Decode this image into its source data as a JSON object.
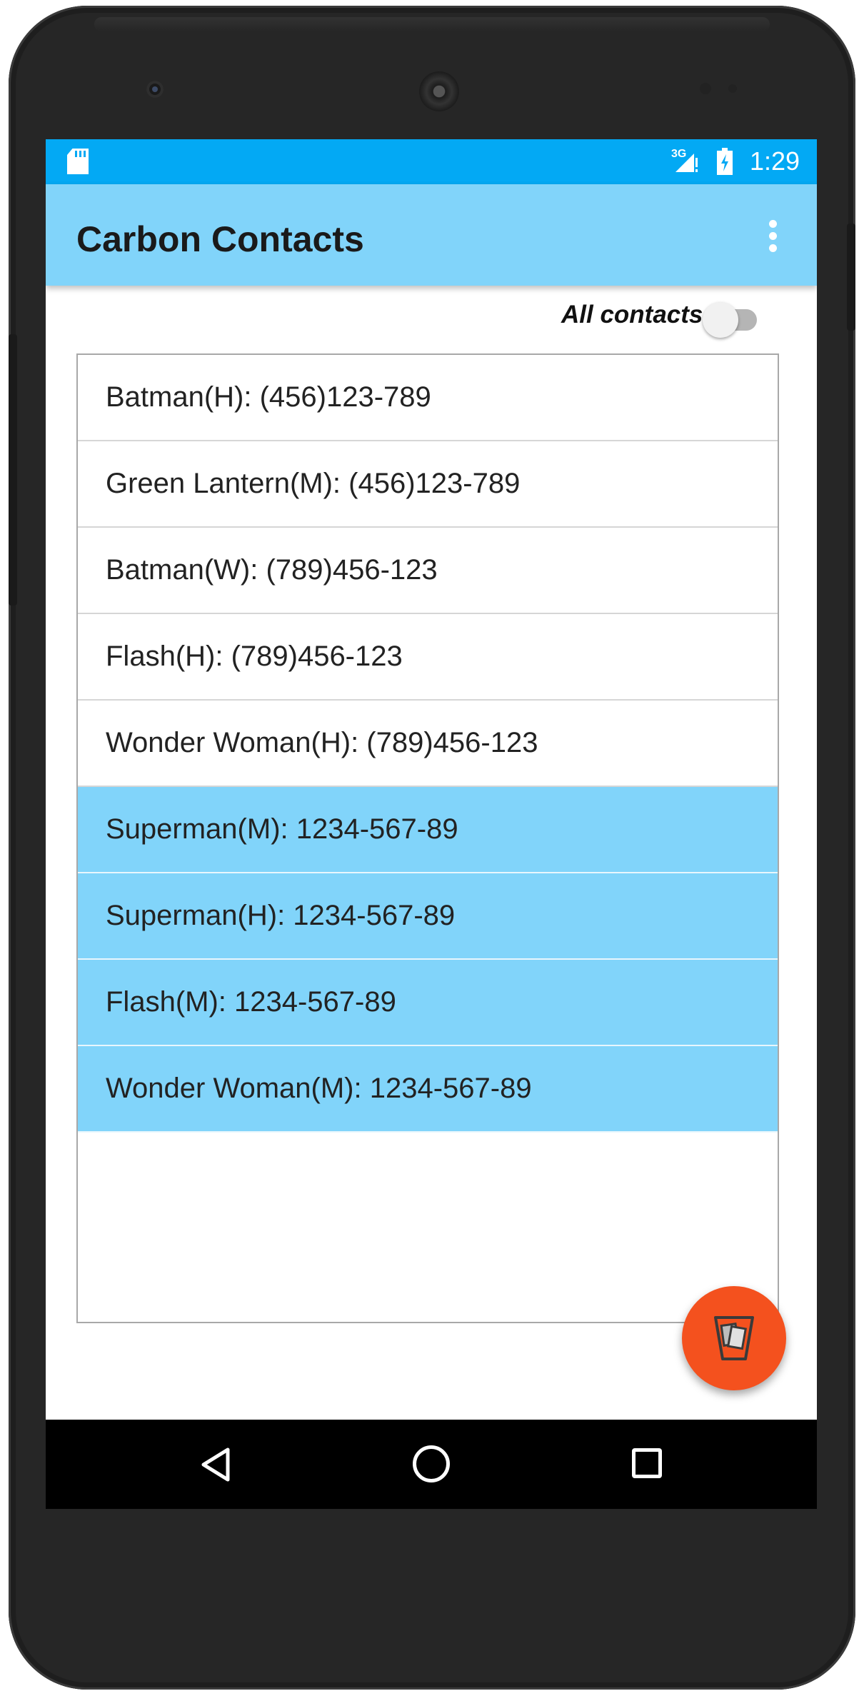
{
  "status_bar": {
    "network_label": "3G",
    "time": "1:29",
    "icons": [
      "sd-card-icon",
      "signal-icon",
      "battery-charging-icon"
    ]
  },
  "app_bar": {
    "title": "Carbon Contacts",
    "menu_icon": "overflow-menu-icon"
  },
  "filter": {
    "label": "All contacts",
    "switch_on": false
  },
  "contacts": [
    {
      "text": "Batman(H): (456)123-789",
      "highlighted": false
    },
    {
      "text": "Green Lantern(M): (456)123-789",
      "highlighted": false
    },
    {
      "text": "Batman(W): (789)456-123",
      "highlighted": false
    },
    {
      "text": "Flash(H): (789)456-123",
      "highlighted": false
    },
    {
      "text": "Wonder Woman(H): (789)456-123",
      "highlighted": false
    },
    {
      "text": "Superman(M): 1234-567-89",
      "highlighted": true
    },
    {
      "text": "Superman(H): 1234-567-89",
      "highlighted": true
    },
    {
      "text": "Flash(M): 1234-567-89",
      "highlighted": true
    },
    {
      "text": "Wonder Woman(M): 1234-567-89",
      "highlighted": true
    }
  ],
  "fab": {
    "icon": "carbon-copy-icon"
  },
  "nav_bar": {
    "icons": [
      "back-icon",
      "home-icon",
      "recents-icon"
    ]
  },
  "colors": {
    "status_bar": "#03a9f4",
    "app_bar": "#81d4fa",
    "highlight_row": "#81d4fa",
    "fab": "#f4511e"
  }
}
